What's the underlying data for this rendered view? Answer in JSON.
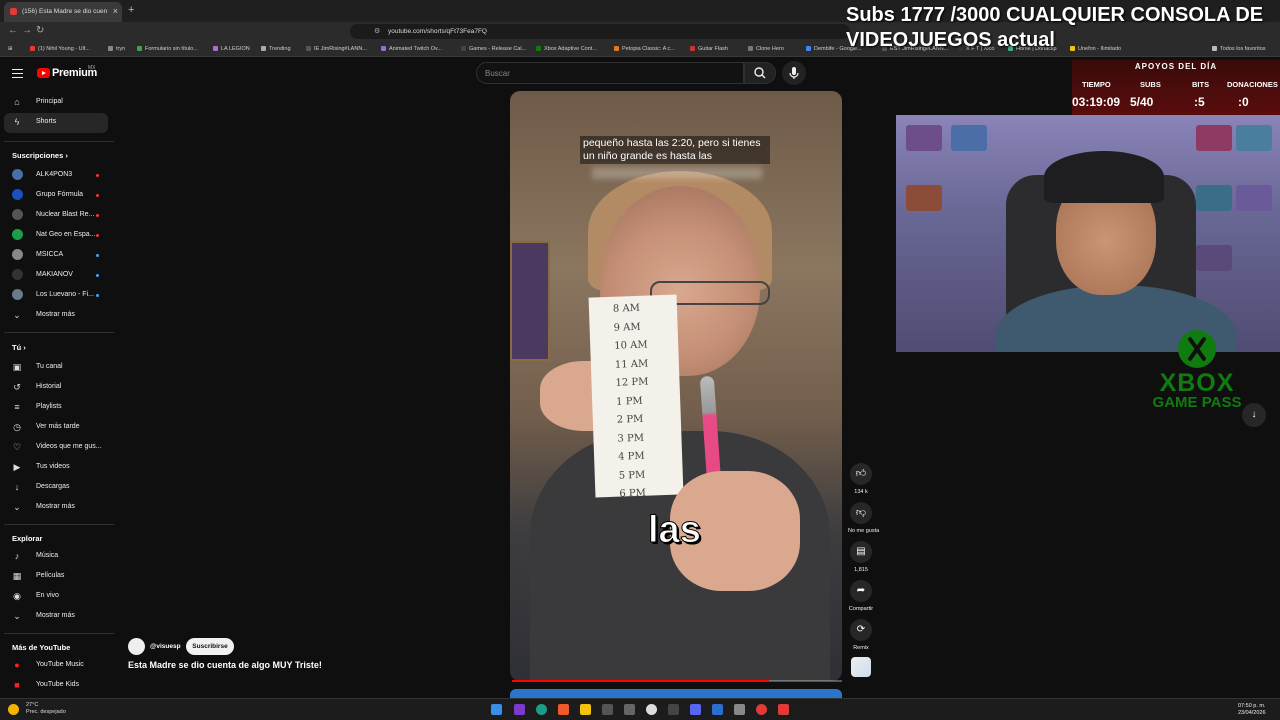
{
  "browser": {
    "tab_title": "(156) Esta Madre se dio cuen",
    "url": "youtube.com/shorts/qFt73Fea7FQ",
    "bookmarks": [
      "(1) Nihil Young - Ult...",
      "tryn",
      "Formulario sin título...",
      "LA LEGION",
      "Trending",
      "IE JimRising#LANN...",
      "Animated Twitch Ov...",
      "Games - Release Cal...",
      "Xbox Adaptive Cont...",
      "Petopia Classic: A c...",
      "Guitar Flash",
      "Clone Hero",
      "Dembife - Google...",
      "EST JimRising#LANN...",
      "X F T | Xico",
      "Home | Donaclip",
      "Unefon - Ilimitado",
      "Todos los favoritos"
    ]
  },
  "youtube": {
    "logo_text": "Premium",
    "logo_country": "MX",
    "search_placeholder": "Buscar",
    "sidebar": {
      "main": [
        {
          "label": "Principal",
          "icon": "home-icon"
        },
        {
          "label": "Shorts",
          "icon": "shorts-icon"
        }
      ],
      "subscriptions_header": "Suscripciones",
      "subscriptions": [
        {
          "label": "ALK4PON3",
          "color": "#4a6fa5"
        },
        {
          "label": "Grupo Fórmula",
          "color": "#1a4fc0"
        },
        {
          "label": "Nuclear Blast Re...",
          "color": "#555555"
        },
        {
          "label": "Nat Geo en Espa...",
          "color": "#1e9e4a"
        },
        {
          "label": "MSICCA",
          "color": "#888888"
        },
        {
          "label": "MAKIANOV",
          "color": "#333333"
        },
        {
          "label": "Los Luevano - Fi...",
          "color": "#6a7a8a"
        }
      ],
      "show_more_1": "Mostrar más",
      "you_header": "Tú",
      "you": [
        {
          "label": "Tu canal",
          "icon": "channel-icon"
        },
        {
          "label": "Historial",
          "icon": "history-icon"
        },
        {
          "label": "Playlists",
          "icon": "playlist-icon"
        },
        {
          "label": "Ver más tarde",
          "icon": "clock-icon"
        },
        {
          "label": "Videos que me gus...",
          "icon": "like-icon"
        },
        {
          "label": "Tus videos",
          "icon": "video-icon"
        },
        {
          "label": "Descargas",
          "icon": "download-icon"
        }
      ],
      "show_more_2": "Mostrar más",
      "explore_header": "Explorar",
      "explore": [
        {
          "label": "Música",
          "icon": "music-icon"
        },
        {
          "label": "Películas",
          "icon": "film-icon"
        },
        {
          "label": "En vivo",
          "icon": "live-icon"
        }
      ],
      "show_more_3": "Mostrar más",
      "more_header": "Más de YouTube",
      "more": [
        {
          "label": "YouTube Music",
          "icon": "yt-music-icon"
        },
        {
          "label": "YouTube Kids",
          "icon": "yt-kids-icon"
        }
      ]
    },
    "short": {
      "subtitle_line1": "pequeño hasta las 2:20, pero si tienes",
      "subtitle_line2": "un niño grande es hasta las",
      "big_caption": "las",
      "paper_times": [
        "8 AM",
        "9 AM",
        "10 AM",
        "11 AM",
        "12 PM",
        "1 PM",
        "2 PM",
        "3 PM",
        "4 PM",
        "5 PM",
        "6 PM"
      ],
      "progress": 0.78,
      "channel": "@visuesp",
      "subscribe_label": "Suscribirse",
      "title": "Esta Madre se dio cuenta de algo MUY Triste!",
      "actions": {
        "likes": "134 k",
        "dislike": "No me gusta",
        "comments": "1,815",
        "share": "Compartir",
        "remix": "Remix"
      }
    }
  },
  "stream": {
    "subs_goal_line1": "Subs 1777 /3000 CUALQUIER CONSOLA DE",
    "subs_goal_line2": "VIDEOJUEGOS actual",
    "apoyos_header": "APOYOS DEL DÍA",
    "tiempo_label": "TIEMPO",
    "tiempo_value": "03:19:09",
    "subs_label": "SUBS",
    "subs_value": "5/40",
    "bits_label": "BITS",
    "bits_value": ":5",
    "donaciones_label": "DONACIONES",
    "donaciones_value": ":0",
    "xbox_line1": "XBOX",
    "xbox_line2": "GAME PASS"
  },
  "taskbar": {
    "temp": "27°C",
    "weather": "Prec. despejado",
    "time": "07:50 p. m.",
    "date": "23/04/2026"
  }
}
